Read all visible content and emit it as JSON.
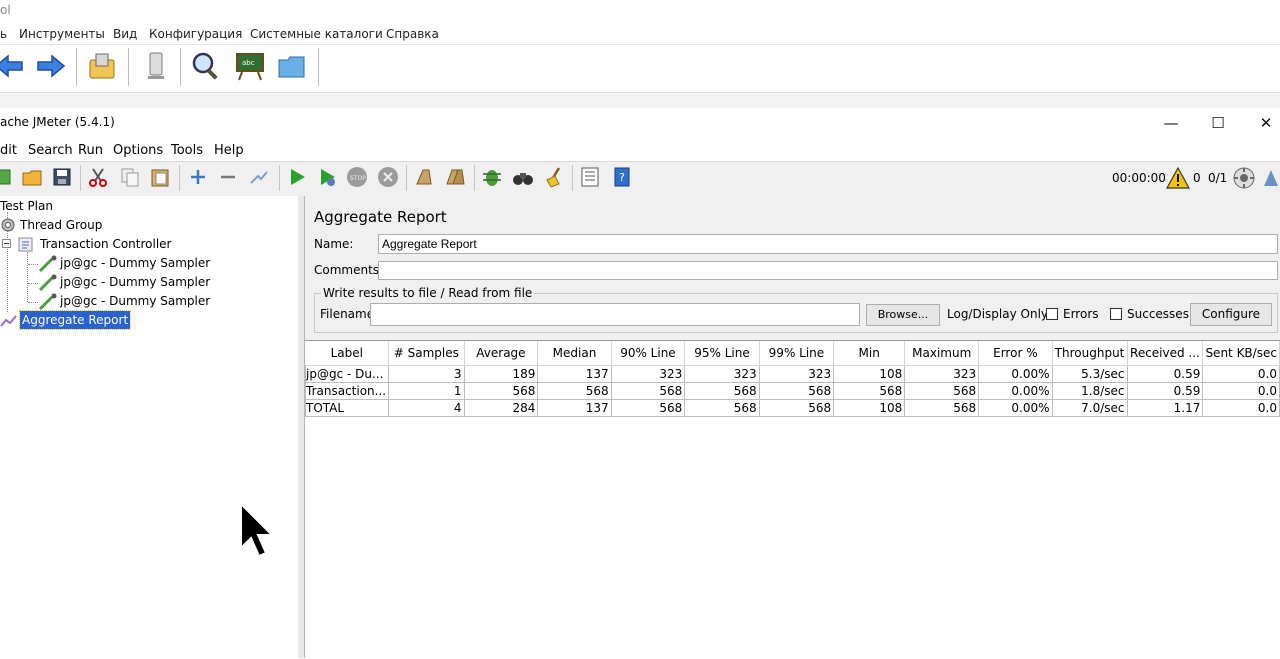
{
  "background_app": {
    "title_fragment": "ol",
    "menu": [
      "ь",
      "Инструменты",
      "Вид",
      "Конфигурация",
      "Системные каталоги",
      "Справка"
    ]
  },
  "window": {
    "title": "ache JMeter (5.4.1)",
    "controls": {
      "minimize": "—",
      "maximize": "☐",
      "close": "✕"
    }
  },
  "menubar": [
    "dit",
    "Search",
    "Run",
    "Options",
    "Tools",
    "Help"
  ],
  "status": {
    "timer": "00:00:00",
    "warnings": "0",
    "threads": "0/1"
  },
  "tree": {
    "items": [
      {
        "label": "Test Plan"
      },
      {
        "label": "Thread Group"
      },
      {
        "label": "Transaction Controller"
      },
      {
        "label": "jp@gc - Dummy Sampler"
      },
      {
        "label": "jp@gc - Dummy Sampler"
      },
      {
        "label": "jp@gc - Dummy Sampler"
      },
      {
        "label": "Aggregate Report"
      }
    ]
  },
  "panel": {
    "title": "Aggregate Report",
    "name_label": "Name:",
    "name_value": "Aggregate Report",
    "comments_label": "Comments:",
    "comments_value": "",
    "fileset_legend": "Write results to file / Read from file",
    "filename_label": "Filename",
    "filename_value": "",
    "browse_label": "Browse...",
    "log_display_label": "Log/Display Only:",
    "errors_label": "Errors",
    "successes_label": "Successes",
    "configure_label": "Configure"
  },
  "table": {
    "headers": [
      "Label",
      "# Samples",
      "Average",
      "Median",
      "90% Line",
      "95% Line",
      "99% Line",
      "Min",
      "Maximum",
      "Error %",
      "Throughput",
      "Received ...",
      "Sent KB/sec"
    ],
    "rows": [
      [
        "jp@gc - Du...",
        "3",
        "189",
        "137",
        "323",
        "323",
        "323",
        "108",
        "323",
        "0.00%",
        "5.3/sec",
        "0.59",
        "0.0"
      ],
      [
        "Transaction...",
        "1",
        "568",
        "568",
        "568",
        "568",
        "568",
        "568",
        "568",
        "0.00%",
        "1.8/sec",
        "0.59",
        "0.0"
      ],
      [
        "TOTAL",
        "4",
        "284",
        "137",
        "568",
        "568",
        "568",
        "108",
        "568",
        "0.00%",
        "7.0/sec",
        "1.17",
        "0.0"
      ]
    ]
  },
  "colors": {
    "selection": "#2a62d4",
    "panel_bg": "#f0f0f0",
    "toolbar_bg": "#f0f0f0"
  }
}
